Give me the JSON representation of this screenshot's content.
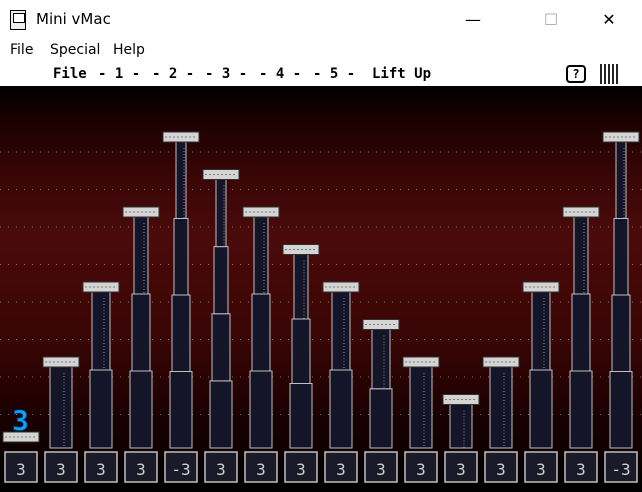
{
  "window": {
    "title": "Mini vMac",
    "minimize_glyph": "—",
    "maximize_glyph": "☐",
    "close_glyph": "✕"
  },
  "window_menu": [
    "File",
    "Special",
    "Help"
  ],
  "mac_menu": {
    "apple": "",
    "items": [
      "File",
      "- 1 -",
      "- 2 -",
      "- 3 -",
      "- 4 -",
      "- 5 -",
      "Lift Up"
    ],
    "help_label": "?"
  },
  "game": {
    "current_lifter_number": "3",
    "platform_labels": [
      "3",
      "3",
      "3",
      "3",
      "-3",
      "3",
      "3",
      "3",
      "3",
      "3",
      "3",
      "3",
      "3",
      "3",
      "3",
      "-3"
    ],
    "column_heights": [
      0,
      2,
      4,
      6,
      8,
      7,
      6,
      5,
      4,
      3,
      2,
      1,
      2,
      4,
      6,
      8
    ],
    "colors": {
      "column_fill": "#15152a",
      "column_stroke": "#c0c0c0",
      "cap_fill": "#d4d4d4",
      "platform_fill": "#1a1a28",
      "number_color": "#00a8ff",
      "dot_color": "#a0a0a0"
    }
  }
}
